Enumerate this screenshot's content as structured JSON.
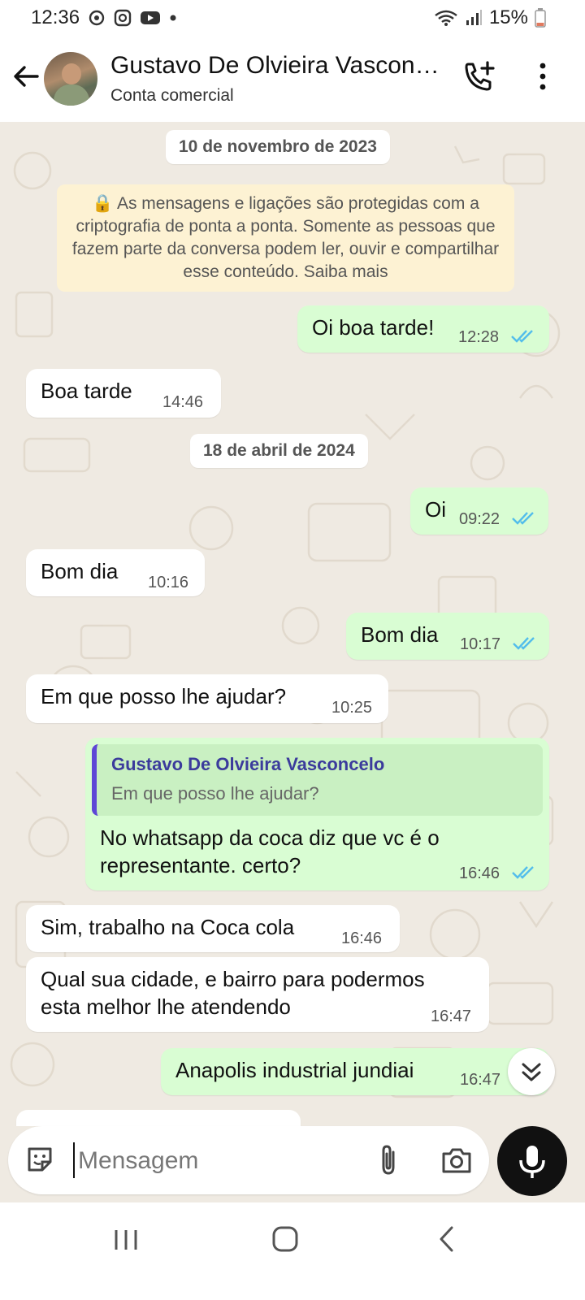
{
  "status_bar": {
    "time": "12:36",
    "battery": "15%",
    "icons": [
      "whatsapp-status-icon",
      "instagram-icon",
      "youtube-icon",
      "dot-icon",
      "wifi-icon",
      "signal-icon",
      "battery-icon"
    ]
  },
  "header": {
    "name": "Gustavo De Olvieira Vascon…",
    "subtitle": "Conta comercial"
  },
  "chat": {
    "date1": "10 de novembro de 2023",
    "encryption_notice": "🔒 As mensagens e ligações são protegidas com a criptografia de ponta a ponta. Somente as pessoas que fazem parte da conversa podem ler, ouvir e compartilhar esse conteúdo. Saiba mais",
    "date2": "18 de abril de 2024",
    "messages": [
      {
        "dir": "out",
        "text": "Oi boa tarde!",
        "time": "12:28",
        "status": "read"
      },
      {
        "dir": "in",
        "text": "Boa tarde",
        "time": "14:46"
      },
      {
        "dir": "out",
        "text": "Oi",
        "time": "09:22",
        "status": "read"
      },
      {
        "dir": "in",
        "text": "Bom dia",
        "time": "10:16"
      },
      {
        "dir": "out",
        "text": "Bom dia",
        "time": "10:17",
        "status": "read"
      },
      {
        "dir": "in",
        "text": "Em que posso lhe ajudar?",
        "time": "10:25"
      },
      {
        "dir": "out",
        "quote_name": "Gustavo De Olvieira Vasconcelo",
        "quote_text": "Em que posso lhe ajudar?",
        "line1": "No whatsapp da coca diz que vc é o",
        "line2": "representante. certo?",
        "time": "16:46",
        "status": "read"
      },
      {
        "dir": "in",
        "text": "Sim, trabalho na Coca cola",
        "time": "16:46"
      },
      {
        "dir": "in",
        "line1": "Qual sua cidade, e bairro para podermos",
        "line2": "esta melhor lhe atendendo",
        "time": "16:47"
      },
      {
        "dir": "out",
        "text": "Anapolis industrial jundiai",
        "time": "16:47",
        "status": "read"
      }
    ]
  },
  "input": {
    "placeholder": "Mensagem"
  },
  "colors": {
    "outgoing": "#d9fdd3",
    "incoming": "#ffffff",
    "read_ticks": "#53bdeb",
    "notice": "#fdf2d3"
  }
}
